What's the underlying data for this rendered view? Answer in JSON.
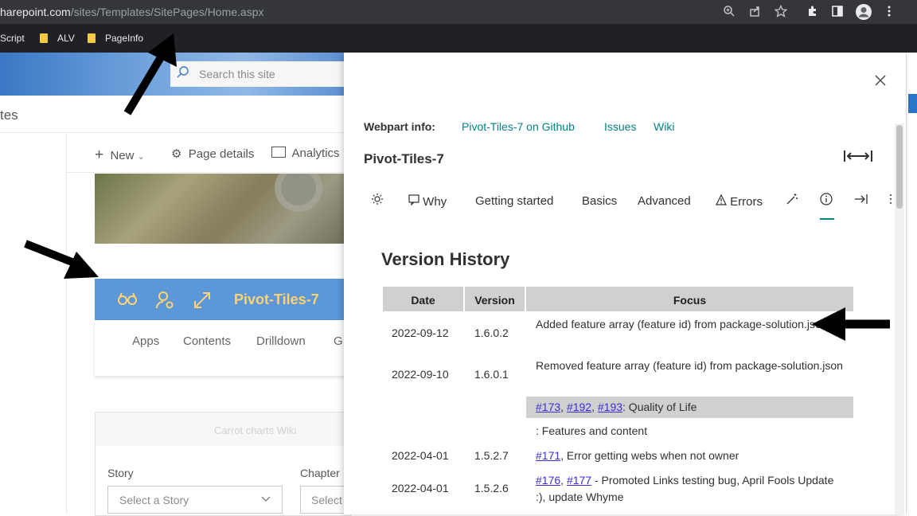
{
  "browser": {
    "url_host": "harepoint.com",
    "url_path": "/sites/Templates/SitePages/Home.aspx",
    "bookmarks": [
      "Script",
      "ALV",
      "PageInfo"
    ],
    "icons": [
      "zoom-icon",
      "share-icon",
      "star-icon",
      "extensions-icon",
      "sidepanel-icon",
      "profile-icon",
      "menu-icon"
    ]
  },
  "sharepoint": {
    "search_placeholder": "Search this site",
    "site_title_fragment": "tes",
    "commands": {
      "new": "New",
      "page_details": "Page details",
      "analytics": "Analytics"
    },
    "pivot_tiles": {
      "title": "Pivot-Tiles-7",
      "tabs": [
        "Apps",
        "Contents",
        "Drilldown",
        "G"
      ]
    },
    "carrot_charts": {
      "title": "Carrot charts Wiki",
      "story_label": "Story",
      "story_placeholder": "Select a Story",
      "chapter_label": "Chapter",
      "chapter_placeholder": "Select"
    }
  },
  "panel": {
    "webpart_info_label": "Webpart info:",
    "links": [
      "Pivot-Tiles-7 on Github",
      "Issues",
      "Wiki"
    ],
    "title": "Pivot-Tiles-7",
    "tabs": [
      {
        "label": "",
        "icon": "sun-icon"
      },
      {
        "label": "Why",
        "icon": "chat-icon"
      },
      {
        "label": "Getting started"
      },
      {
        "label": "Basics"
      },
      {
        "label": "Advanced"
      },
      {
        "label": "Errors",
        "icon": "warning-icon"
      },
      {
        "label": "",
        "icon": "magic-wand-icon"
      },
      {
        "label": "",
        "icon": "info-icon",
        "active": true
      },
      {
        "label": "",
        "icon": "export-icon"
      }
    ],
    "version_history": {
      "title": "Version History",
      "headers": [
        "Date",
        "Version",
        "Focus"
      ],
      "rows": [
        {
          "date": "2022-09-12",
          "version": "1.6.0.2",
          "focus": "Added feature array (feature id) from package-solution.json"
        },
        {
          "date": "2022-09-10",
          "version": "1.6.0.1",
          "focus": "Removed feature array (feature id) from package-solution.json"
        },
        {
          "date": "",
          "version": "",
          "focus_links": [
            "#173",
            "#192",
            "#193"
          ],
          "focus": ": Quality of Life",
          "highlight": true
        },
        {
          "date": "",
          "version": "",
          "focus": ": Features and content"
        },
        {
          "date": "2022-04-01",
          "version": "1.5.2.7",
          "focus_links": [
            "#171"
          ],
          "focus": ", Error getting webs when not owner"
        },
        {
          "date": "2022-04-01",
          "version": "1.5.2.6",
          "focus_links": [
            "#176",
            "#177"
          ],
          "focus": " - Promoted Links testing bug, April Fools Update :), update Whyme"
        }
      ]
    }
  },
  "colors": {
    "accent": "#038387",
    "tile_bar": "#5b97d9",
    "tile_text": "#ffd36e",
    "link": "#3a2fd0"
  }
}
